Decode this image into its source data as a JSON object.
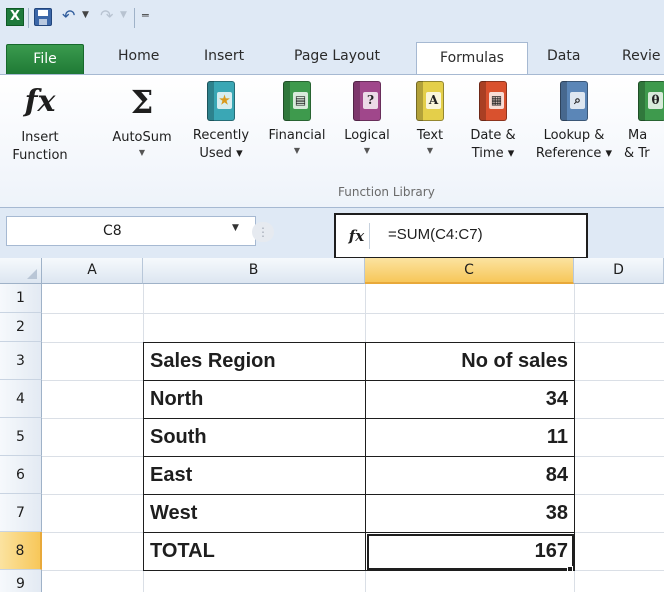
{
  "quick_access": {
    "items": [
      "excel-logo",
      "save-icon",
      "undo-icon",
      "redo-icon",
      "customize-icon"
    ]
  },
  "tabs": {
    "file": "File",
    "home": "Home",
    "insert": "Insert",
    "page_layout": "Page Layout",
    "formulas": "Formulas",
    "data": "Data",
    "review": "Revie"
  },
  "ribbon": {
    "insert_function": [
      "Insert",
      "Function"
    ],
    "autosum": "AutoSum",
    "recently_used": [
      "Recently",
      "Used"
    ],
    "financial": "Financial",
    "logical": "Logical",
    "text": "Text",
    "date_time": [
      "Date &",
      "Time"
    ],
    "lookup_reference": [
      "Lookup &",
      "Reference"
    ],
    "math_trig": [
      "Ma",
      "& Tr"
    ],
    "group_label": "Function Library",
    "colors": {
      "recently_used": "#3aa7b5",
      "financial": "#3e9a4d",
      "logical": "#a0478b",
      "text": "#e4cf4a",
      "date_time": "#d9512e",
      "lookup_reference": "#5b86b7",
      "math_trig": "#3e9a4d"
    }
  },
  "formula_bar": {
    "name_box": "C8",
    "fx_label": "fx",
    "formula": "=SUM(C4:C7)"
  },
  "sheet": {
    "columns": [
      "A",
      "B",
      "C",
      "D"
    ],
    "active_column": "C",
    "rows": [
      "1",
      "2",
      "3",
      "4",
      "5",
      "6",
      "7",
      "8",
      "9"
    ],
    "active_row": "8",
    "table": [
      {
        "region": "Sales Region",
        "value": "No of sales"
      },
      {
        "region": "North",
        "value": "34"
      },
      {
        "region": "South",
        "value": "11"
      },
      {
        "region": "East",
        "value": "84"
      },
      {
        "region": "West",
        "value": "38"
      },
      {
        "region": "TOTAL",
        "value": "167"
      }
    ]
  }
}
